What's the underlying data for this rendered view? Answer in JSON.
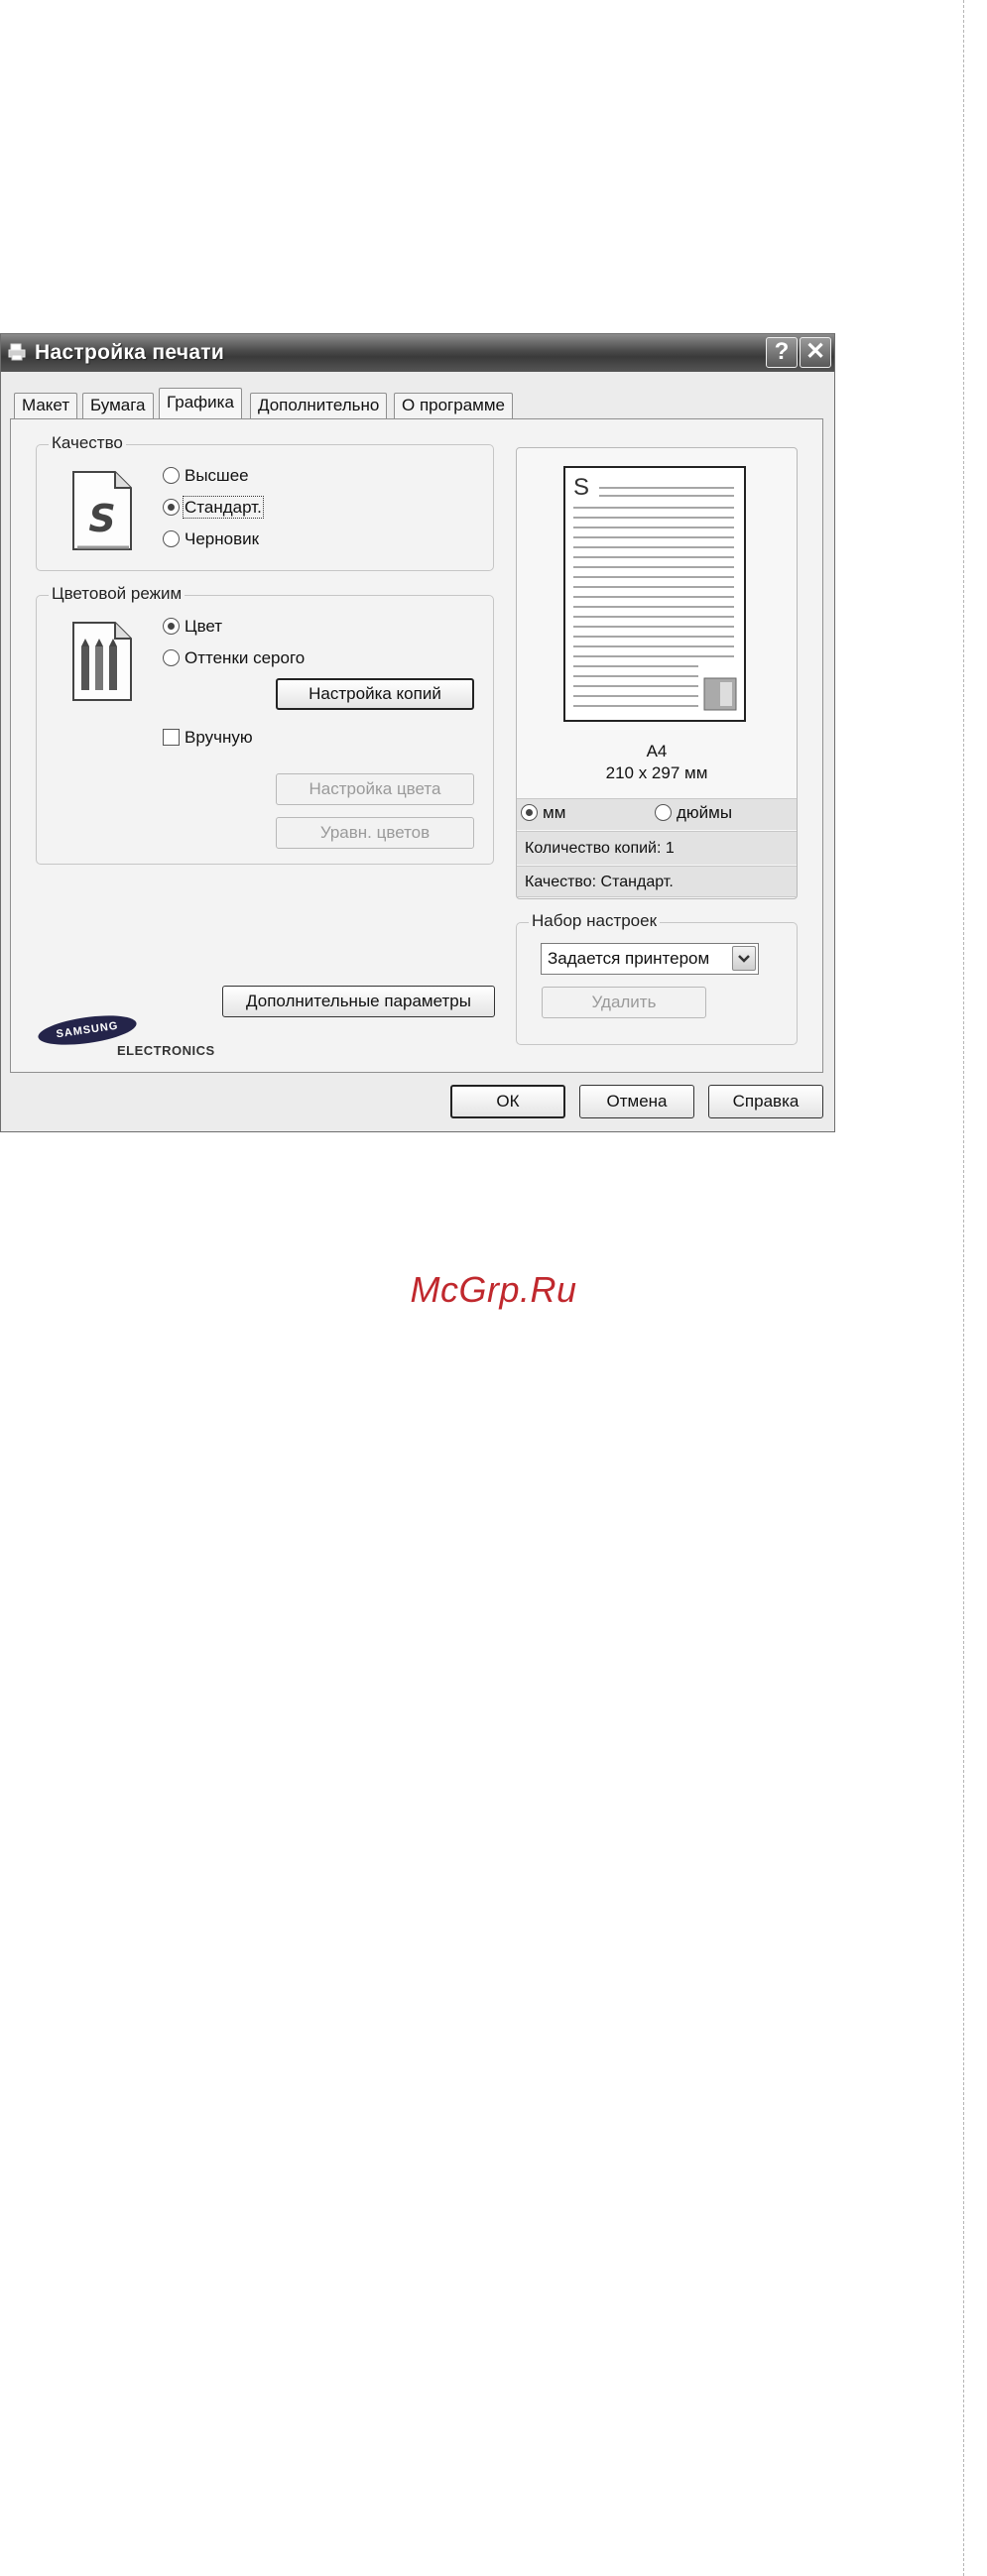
{
  "window": {
    "title": "Настройка печати",
    "help_btn": "?",
    "close_btn": "✕"
  },
  "tabs": [
    {
      "label": "Макет"
    },
    {
      "label": "Бумага"
    },
    {
      "label": "Графика"
    },
    {
      "label": "Дополнительно"
    },
    {
      "label": "О программе"
    }
  ],
  "quality": {
    "label": "Качество",
    "options": [
      "Высшее",
      "Стандарт.",
      "Черновик"
    ],
    "selected": "Стандарт."
  },
  "color_mode": {
    "label": "Цветовой режим",
    "options": [
      "Цвет",
      "Оттенки серого"
    ],
    "selected": "Цвет",
    "copy_settings_btn": "Настройка копий",
    "manual_label": "Вручную",
    "color_settings_btn": "Настройка цвета",
    "color_match_btn": "Уравн. цветов"
  },
  "preview": {
    "page_letter": "S",
    "paper_name": "A4",
    "paper_size": "210 x 297 мм",
    "unit_mm": "мм",
    "unit_inch": "дюймы",
    "copies": "Количество копий: 1",
    "quality": "Качество: Стандарт."
  },
  "presets": {
    "label": "Набор настроек",
    "selected": "Задается принтером",
    "delete_btn": "Удалить"
  },
  "advanced_btn": "Дополнительные параметры",
  "branding": {
    "brand": "SAMSUNG",
    "sub": "ELECTRONICS"
  },
  "footer": {
    "ok": "ОК",
    "cancel": "Отмена",
    "help": "Справка"
  },
  "watermark": "McGrp.Ru"
}
